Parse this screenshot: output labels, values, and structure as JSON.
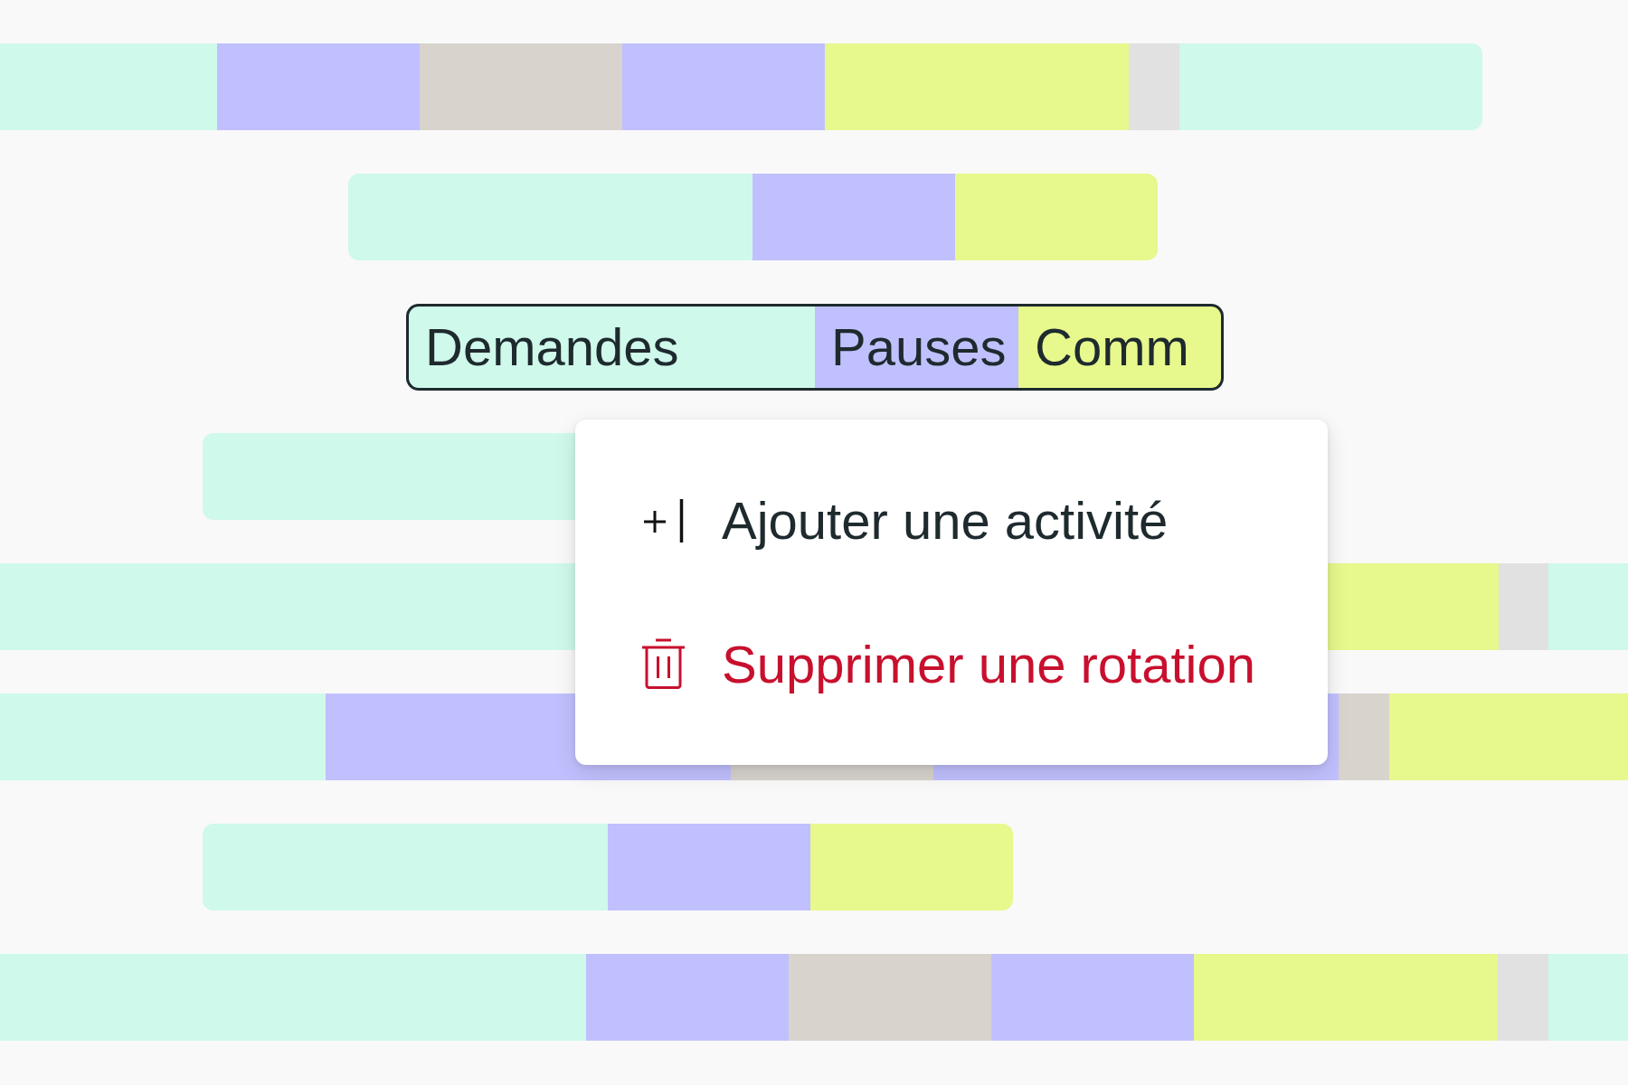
{
  "rows": [
    {
      "selected": false,
      "segments": [
        {
          "color": "#cff9ea"
        },
        {
          "color": "#c1c0ff"
        },
        {
          "color": "#d8d3cd"
        },
        {
          "color": "#c1c0ff"
        },
        {
          "color": "#e7f88d"
        },
        {
          "color": "#e1e1e1"
        },
        {
          "color": "#cff9ea"
        }
      ]
    },
    {
      "selected": false,
      "segments": [
        {
          "color": "#cff9ea"
        },
        {
          "color": "#c1c0ff"
        },
        {
          "color": "#e7f88d"
        }
      ]
    },
    {
      "selected": true,
      "segments": [
        {
          "label": "Demandes",
          "color": "#cff9ea"
        },
        {
          "label": "Pauses",
          "color": "#c1c0ff"
        },
        {
          "label": "Comm",
          "color": "#e7f88d"
        }
      ]
    },
    {
      "selected": false,
      "segments": [
        {
          "color": "#cff9ea"
        }
      ]
    },
    {
      "selected": false,
      "segments": [
        {
          "color": "#cff9ea"
        },
        {
          "color": "#e7f88d"
        },
        {
          "color": "#e1e1e1"
        },
        {
          "color": "#cff9ea"
        }
      ]
    },
    {
      "selected": false,
      "segments": [
        {
          "color": "#cff9ea"
        },
        {
          "color": "#c1c0ff"
        },
        {
          "color": "#d8d3cd"
        },
        {
          "color": "#c1c0ff"
        },
        {
          "color": "#d8d3cd"
        },
        {
          "color": "#e7f88d"
        }
      ]
    },
    {
      "selected": false,
      "segments": [
        {
          "color": "#cff9ea"
        },
        {
          "color": "#c1c0ff"
        },
        {
          "color": "#e7f88d"
        }
      ]
    },
    {
      "selected": false,
      "segments": [
        {
          "color": "#cff9ea"
        },
        {
          "color": "#c1c0ff"
        },
        {
          "color": "#d8d3cd"
        },
        {
          "color": "#c1c0ff"
        },
        {
          "color": "#e7f88d"
        },
        {
          "color": "#e1e1e1"
        },
        {
          "color": "#cff9ea"
        }
      ]
    }
  ],
  "context_menu": {
    "items": [
      {
        "kind": "insert",
        "label": "Ajouter une activité"
      },
      {
        "kind": "destructive",
        "label": "Supprimer une rotation"
      }
    ]
  }
}
